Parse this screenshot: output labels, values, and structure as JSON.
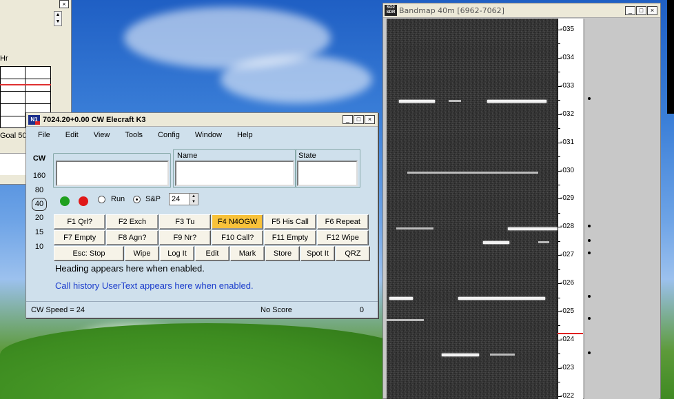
{
  "bg_window": {
    "close": "×",
    "hr_label": "Hr",
    "goal": "Goal 50"
  },
  "main_window": {
    "title": "7024.20+0.00 CW Elecraft K3",
    "app_icon": "N1",
    "menu": [
      "File",
      "Edit",
      "View",
      "Tools",
      "Config",
      "Window",
      "Help"
    ],
    "mode": "CW",
    "bands": [
      "160",
      "80",
      "40",
      "20",
      "15",
      "10"
    ],
    "active_band": "40",
    "fields": {
      "call": {
        "label": "",
        "value": ""
      },
      "name": {
        "label": "Name",
        "value": ""
      },
      "state": {
        "label": "State",
        "value": ""
      }
    },
    "run_label": "Run",
    "sp_label": "S&P",
    "sp_selected": true,
    "speed_value": "24",
    "led_colors": {
      "green": "#1fa01f",
      "red": "#e01818"
    },
    "fkeys_row1": [
      "F1 Qrl?",
      "F2 Exch",
      "F3 Tu",
      "F4 N4OGW",
      "F5 His Call",
      "F6 Repeat"
    ],
    "fkeys_row2": [
      "F7 Empty",
      "F8 Agn?",
      "F9 Nr?",
      "F10 Call?",
      "F11 Empty",
      "F12 Wipe"
    ],
    "fkeys_row3": [
      "Esc: Stop",
      "Wipe",
      "Log It",
      "Edit",
      "Mark",
      "Store",
      "Spot It",
      "QRZ"
    ],
    "highlight_key": "F4 N4OGW",
    "heading_text": "Heading appears here when enabled.",
    "history_text": "Call history UserText appears here when enabled.",
    "status": {
      "speed": "CW Speed = 24",
      "score": "No Score",
      "count": "0"
    },
    "window_buttons": [
      "_",
      "□",
      "×"
    ]
  },
  "bandmap": {
    "icon": "SO2 SDR",
    "title": "Bandmap 40m [6962-7062]",
    "scale_labels": [
      "035",
      "034",
      "033",
      "032",
      "031",
      "030",
      "029",
      "028",
      "027",
      "026",
      "025",
      "024",
      "023",
      "022"
    ],
    "marker_freq": "024.2",
    "accent_color": "#e02020"
  }
}
